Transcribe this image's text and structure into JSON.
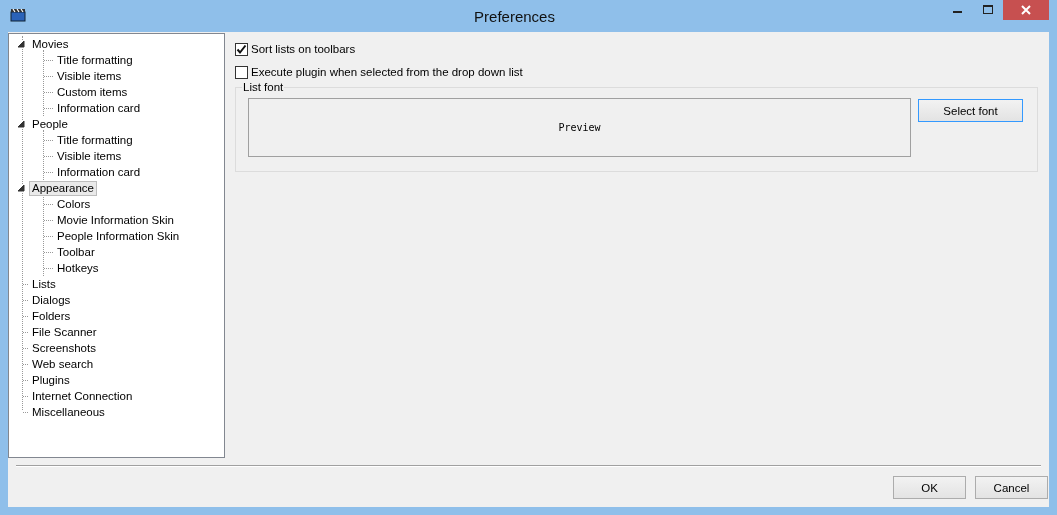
{
  "window": {
    "title": "Preferences"
  },
  "tree": [
    {
      "label": "Movies",
      "expanded": true,
      "selected": false,
      "children": [
        {
          "label": "Title formatting",
          "selected": false
        },
        {
          "label": "Visible items",
          "selected": false
        },
        {
          "label": "Custom items",
          "selected": false
        },
        {
          "label": "Information card",
          "selected": false
        }
      ]
    },
    {
      "label": "People",
      "expanded": true,
      "selected": false,
      "children": [
        {
          "label": "Title formatting",
          "selected": false
        },
        {
          "label": "Visible items",
          "selected": false
        },
        {
          "label": "Information card",
          "selected": false
        }
      ]
    },
    {
      "label": "Appearance",
      "expanded": true,
      "selected": true,
      "children": [
        {
          "label": "Colors",
          "selected": false
        },
        {
          "label": "Movie Information Skin",
          "selected": false
        },
        {
          "label": "People Information Skin",
          "selected": false
        },
        {
          "label": "Toolbar",
          "selected": false
        },
        {
          "label": "Hotkeys",
          "selected": false
        }
      ]
    },
    {
      "label": "Lists",
      "selected": false
    },
    {
      "label": "Dialogs",
      "selected": false
    },
    {
      "label": "Folders",
      "selected": false
    },
    {
      "label": "File Scanner",
      "selected": false
    },
    {
      "label": "Screenshots",
      "selected": false
    },
    {
      "label": "Web search",
      "selected": false
    },
    {
      "label": "Plugins",
      "selected": false
    },
    {
      "label": "Internet Connection",
      "selected": false
    },
    {
      "label": "Miscellaneous",
      "selected": false
    }
  ],
  "options": [
    {
      "label": "Sort lists on toolbars",
      "checked": true
    },
    {
      "label": "Execute plugin when selected from the drop down list",
      "checked": false
    }
  ],
  "list_font": {
    "title": "List font",
    "preview": "Preview",
    "button": "Select font"
  },
  "buttons": [
    "OK",
    "Cancel"
  ]
}
